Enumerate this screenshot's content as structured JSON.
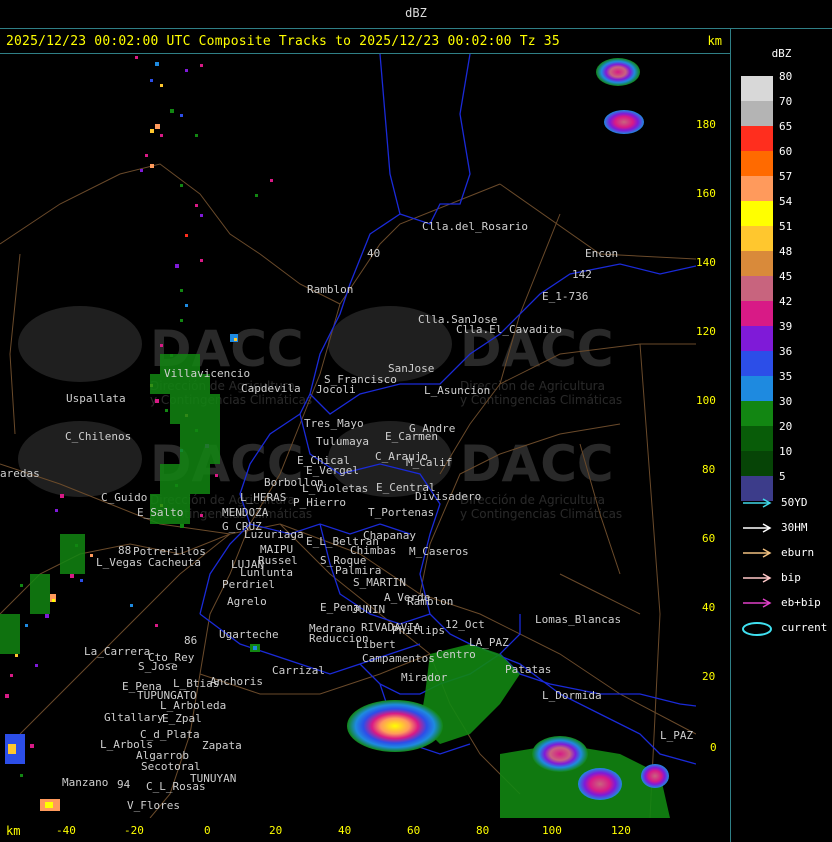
{
  "header": {
    "unit_title": "dBZ",
    "title": "2025/12/23 00:02:00 UTC Composite Tracks to 2025/12/23 00:02:00 Tz 35",
    "km_label": "km"
  },
  "legend": {
    "unit": "dBZ",
    "levels": [
      {
        "label": "80",
        "color": "#d8d8d8"
      },
      {
        "label": "70",
        "color": "#b4b4b4"
      },
      {
        "label": "65",
        "color": "#ff2e1e"
      },
      {
        "label": "60",
        "color": "#ff6a00"
      },
      {
        "label": "57",
        "color": "#ff9a5c"
      },
      {
        "label": "54",
        "color": "#ffff00"
      },
      {
        "label": "51",
        "color": "#ffc72e"
      },
      {
        "label": "48",
        "color": "#d98a3a"
      },
      {
        "label": "45",
        "color": "#c8647e"
      },
      {
        "label": "42",
        "color": "#d81a86"
      },
      {
        "label": "39",
        "color": "#7f1ad8"
      },
      {
        "label": "36",
        "color": "#2c4ee8"
      },
      {
        "label": "35",
        "color": "#1e8ae0"
      },
      {
        "label": "30",
        "color": "#128612"
      },
      {
        "label": "20",
        "color": "#085c08"
      },
      {
        "label": "10",
        "color": "#064406"
      },
      {
        "label": "5",
        "color": "#3c3c8a"
      }
    ],
    "tracks": [
      {
        "label": "50YD",
        "color": "#40d8e8"
      },
      {
        "label": "30HM",
        "color": "#ffffff"
      },
      {
        "label": "eburn",
        "color": "#f0c080"
      },
      {
        "label": "bip",
        "color": "#ffc8c8"
      },
      {
        "label": "eb+bip",
        "color": "#e040c8"
      }
    ],
    "current_label": "current",
    "current_color": "#40e0f0"
  },
  "axes": {
    "x_label": "km",
    "x_ticks": [
      "-40",
      "-20",
      "0",
      "20",
      "40",
      "60",
      "80",
      "100",
      "120"
    ],
    "y_ticks": [
      "180",
      "160",
      "140",
      "120",
      "100",
      "80",
      "60",
      "40",
      "20",
      "0"
    ]
  },
  "watermark": {
    "brand": "DACC",
    "line1": "Dirección de Agricultura",
    "line2": "y Contingencias Climáticas"
  },
  "places": [
    {
      "id": "p1",
      "name": "Clla.del_Rosario"
    },
    {
      "id": "p2",
      "name": "Encon"
    },
    {
      "id": "p3",
      "name": "142"
    },
    {
      "id": "p4",
      "name": "E_1-736"
    },
    {
      "id": "p5",
      "name": "Ramblon"
    },
    {
      "id": "p6",
      "name": "Clla.SanJose"
    },
    {
      "id": "p7",
      "name": "Clla.El_Cavadito"
    },
    {
      "id": "p8",
      "name": "40"
    },
    {
      "id": "p9",
      "name": "Villavicencio"
    },
    {
      "id": "p10",
      "name": "Capdevila"
    },
    {
      "id": "p11",
      "name": "S_Francisco"
    },
    {
      "id": "p12",
      "name": "Jocoli"
    },
    {
      "id": "p13",
      "name": "SanJose"
    },
    {
      "id": "p14",
      "name": "L_Asuncion"
    },
    {
      "id": "p15",
      "name": "Uspallata"
    },
    {
      "id": "p16",
      "name": "Tres_Mayo"
    },
    {
      "id": "p17",
      "name": "G_Andre"
    },
    {
      "id": "p18",
      "name": "C_Chilenos"
    },
    {
      "id": "p19",
      "name": "Tulumaya"
    },
    {
      "id": "p20",
      "name": "E_Carmen"
    },
    {
      "id": "p21",
      "name": "C_Araujo"
    },
    {
      "id": "p22",
      "name": "E_Chical"
    },
    {
      "id": "p23",
      "name": "M_Calif"
    },
    {
      "id": "p24",
      "name": "E_Vergel"
    },
    {
      "id": "p25",
      "name": "aredas"
    },
    {
      "id": "p26",
      "name": "Borbollon"
    },
    {
      "id": "p27",
      "name": "L_Violetas"
    },
    {
      "id": "p28",
      "name": "E_Central"
    },
    {
      "id": "p29",
      "name": "Divisadero"
    },
    {
      "id": "p30",
      "name": "C_Guido"
    },
    {
      "id": "p31",
      "name": "L_HERAS"
    },
    {
      "id": "p32",
      "name": "P_Hierro"
    },
    {
      "id": "p33",
      "name": "E_Salto"
    },
    {
      "id": "p34",
      "name": "MENDOZA"
    },
    {
      "id": "p35",
      "name": "T_Portenas"
    },
    {
      "id": "p36",
      "name": "G_CRUZ"
    },
    {
      "id": "p37",
      "name": "Luzuriaga"
    },
    {
      "id": "p38",
      "name": "Chapanay"
    },
    {
      "id": "p39",
      "name": "E_L_Beltran"
    },
    {
      "id": "p40",
      "name": "MAIPU"
    },
    {
      "id": "p41",
      "name": "Chimbas"
    },
    {
      "id": "p42",
      "name": "M_Caseros"
    },
    {
      "id": "p43",
      "name": "88"
    },
    {
      "id": "p44",
      "name": "Potrerillos"
    },
    {
      "id": "p45",
      "name": "Russel"
    },
    {
      "id": "p46",
      "name": "S_Roque"
    },
    {
      "id": "p47",
      "name": "L_Vegas"
    },
    {
      "id": "p48",
      "name": "Cacheuta"
    },
    {
      "id": "p49",
      "name": "LUJAN"
    },
    {
      "id": "p50",
      "name": "Lunlunta"
    },
    {
      "id": "p51",
      "name": "Palmira"
    },
    {
      "id": "p52",
      "name": "S_MARTIN"
    },
    {
      "id": "p53",
      "name": "Perdriel"
    },
    {
      "id": "p54",
      "name": "A_Verde"
    },
    {
      "id": "p55",
      "name": "Agrelo"
    },
    {
      "id": "p56",
      "name": "Ramblon"
    },
    {
      "id": "p57",
      "name": "E_Pena"
    },
    {
      "id": "p58",
      "name": "JUNIN"
    },
    {
      "id": "p59",
      "name": "Lomas_Blancas"
    },
    {
      "id": "p60",
      "name": "RIVADAVIA"
    },
    {
      "id": "p61",
      "name": "Phillips"
    },
    {
      "id": "p62",
      "name": "12_Oct"
    },
    {
      "id": "p63",
      "name": "Ugarteche"
    },
    {
      "id": "p64",
      "name": "Medrano"
    },
    {
      "id": "p65",
      "name": "Reduccion"
    },
    {
      "id": "p66",
      "name": "86"
    },
    {
      "id": "p67",
      "name": "Libert"
    },
    {
      "id": "p68",
      "name": "LA_PAZ"
    },
    {
      "id": "p69",
      "name": "Campamentos"
    },
    {
      "id": "p70",
      "name": "Centro"
    },
    {
      "id": "p71",
      "name": "La_Carrera"
    },
    {
      "id": "p72",
      "name": "Cto_Rey"
    },
    {
      "id": "p73",
      "name": "S_Jose"
    },
    {
      "id": "p74",
      "name": "Carrizal"
    },
    {
      "id": "p75",
      "name": "Patatas"
    },
    {
      "id": "p76",
      "name": "Mirador"
    },
    {
      "id": "p77",
      "name": "Anchoris"
    },
    {
      "id": "p78",
      "name": "E_Pena"
    },
    {
      "id": "p79",
      "name": "L_Btias"
    },
    {
      "id": "p80",
      "name": "TUPUNGATO"
    },
    {
      "id": "p81",
      "name": "L_Dormida"
    },
    {
      "id": "p82",
      "name": "L_Arboleda"
    },
    {
      "id": "p83",
      "name": "Gltallary"
    },
    {
      "id": "p84",
      "name": "E_Zpal"
    },
    {
      "id": "p85",
      "name": "C_d_Plata"
    },
    {
      "id": "p86",
      "name": "L_PAZ"
    },
    {
      "id": "p87",
      "name": "L_Arbols"
    },
    {
      "id": "p88",
      "name": "Zapata"
    },
    {
      "id": "p89",
      "name": "Algarrob"
    },
    {
      "id": "p90",
      "name": "Secotoral"
    },
    {
      "id": "p91",
      "name": "TUNUYAN"
    },
    {
      "id": "p92",
      "name": "Manzano"
    },
    {
      "id": "p93",
      "name": "94"
    },
    {
      "id": "p94",
      "name": "C_L_Rosas"
    },
    {
      "id": "p95",
      "name": "V_Flores"
    }
  ]
}
